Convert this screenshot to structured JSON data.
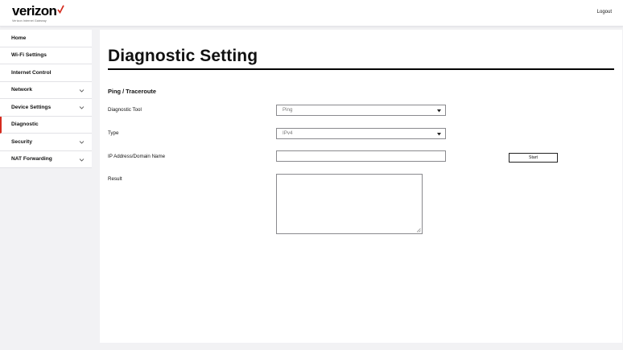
{
  "brand": {
    "name": "verizon",
    "tagline": "Verizon Internet Gateway",
    "accent_color": "#d52b1e"
  },
  "header": {
    "logout_label": "Logout"
  },
  "sidebar": {
    "items": [
      {
        "label": "Home",
        "has_submenu": false,
        "active": false
      },
      {
        "label": "Wi-Fi Settings",
        "has_submenu": false,
        "active": false
      },
      {
        "label": "Internet Control",
        "has_submenu": false,
        "active": false
      },
      {
        "label": "Network",
        "has_submenu": true,
        "active": false
      },
      {
        "label": "Device Settings",
        "has_submenu": true,
        "active": false
      },
      {
        "label": "Diagnostic",
        "has_submenu": false,
        "active": true
      },
      {
        "label": "Security",
        "has_submenu": true,
        "active": false
      },
      {
        "label": "NAT Forwarding",
        "has_submenu": true,
        "active": false
      }
    ]
  },
  "main": {
    "title": "Diagnostic Setting",
    "section_title": "Ping / Traceroute",
    "diagnostic_tool": {
      "label": "Diagnostic Tool",
      "value": "Ping"
    },
    "type": {
      "label": "Type",
      "value": "IPv4"
    },
    "address": {
      "label": "IP Address/Domain Name",
      "value": ""
    },
    "start_label": "Start",
    "result": {
      "label": "Result",
      "value": ""
    }
  }
}
